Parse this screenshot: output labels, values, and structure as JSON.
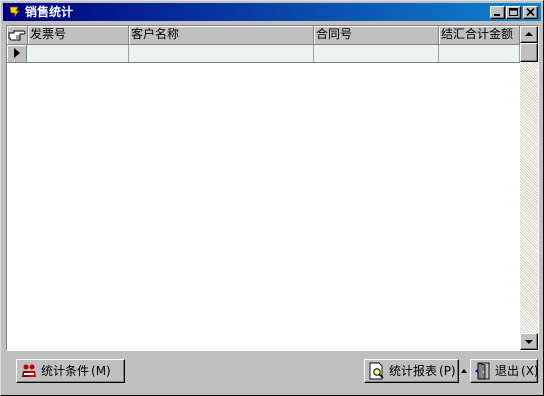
{
  "window": {
    "title": "销售统计",
    "controls": {
      "minimize": "minimize",
      "maximize": "maximize",
      "close": "close"
    }
  },
  "grid": {
    "columns": [
      {
        "label": "发票号"
      },
      {
        "label": "客户名称"
      },
      {
        "label": "合同号"
      },
      {
        "label": "结汇合计金额"
      }
    ],
    "rows": [
      {
        "cells": [
          "",
          "",
          "",
          ""
        ]
      }
    ]
  },
  "toolbar": {
    "criteria_label": "统计条件",
    "criteria_hotkey": "(M)",
    "report_label": "统计报表",
    "report_hotkey": "(P)",
    "exit_label": "退出",
    "exit_hotkey": "(X)"
  },
  "icons": {
    "app": "app-icon",
    "corner": "hand-pointer-icon",
    "row_indicator": "row-pointer-icon",
    "criteria": "people-icon",
    "report": "report-magnifier-icon",
    "exit": "exit-door-icon"
  }
}
